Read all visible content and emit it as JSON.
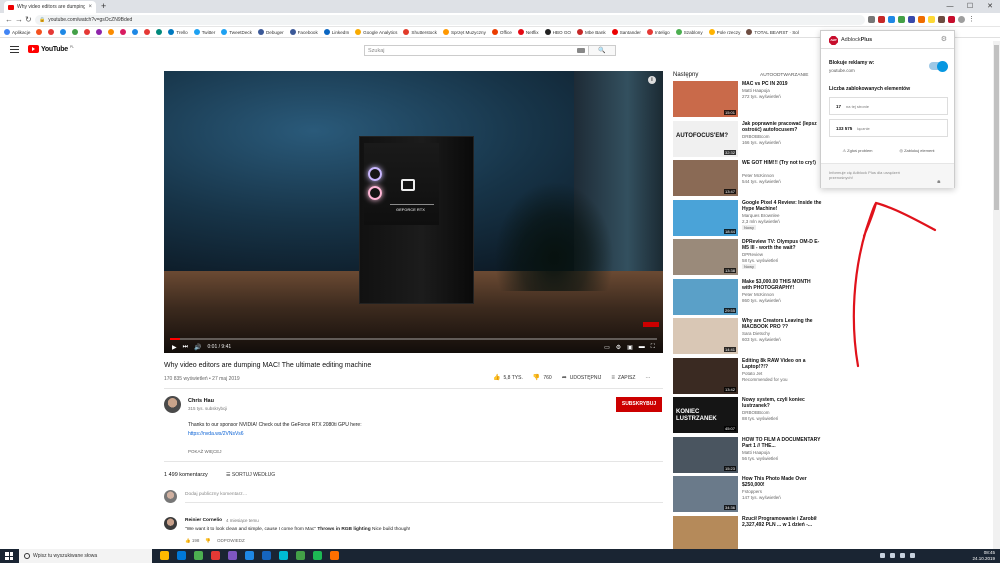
{
  "browser": {
    "tab_title": "Why video editors are dumping...",
    "tab_close": "×",
    "new_tab": "+",
    "url": "youtube.com/watch?v=gsOcZN9Bded",
    "back": "←",
    "forward": "→",
    "reload": "↻",
    "star": "☆",
    "win_min": "—",
    "win_max": "☐",
    "win_close": "✕",
    "menu": "⋮"
  },
  "bookmarks": [
    {
      "label": "Aplikacje",
      "color": "#4285f4"
    },
    {
      "label": "",
      "color": "#f4511e"
    },
    {
      "label": "",
      "color": "#e53935"
    },
    {
      "label": "",
      "color": "#1e88e5"
    },
    {
      "label": "",
      "color": "#43a047"
    },
    {
      "label": "",
      "color": "#e53935"
    },
    {
      "label": "",
      "color": "#8e24aa"
    },
    {
      "label": "",
      "color": "#fb8c00"
    },
    {
      "label": "",
      "color": "#d81b60"
    },
    {
      "label": "",
      "color": "#1e88e5"
    },
    {
      "label": "",
      "color": "#e53935"
    },
    {
      "label": "",
      "color": "#00897b"
    },
    {
      "label": "Trello",
      "color": "#0079bf"
    },
    {
      "label": "Twitter",
      "color": "#1da1f2"
    },
    {
      "label": "TweetDeck",
      "color": "#1da1f2"
    },
    {
      "label": "Debuger",
      "color": "#3b5998"
    },
    {
      "label": "Facebook",
      "color": "#3b5998"
    },
    {
      "label": "LinkedIn",
      "color": "#0a66c2"
    },
    {
      "label": "Google Analytics",
      "color": "#f9ab00"
    },
    {
      "label": "Shutterstock",
      "color": "#e23b2a"
    },
    {
      "label": "Sprzęt Muzyczny",
      "color": "#ff9800"
    },
    {
      "label": "Office",
      "color": "#eb3c00"
    },
    {
      "label": "Netflix",
      "color": "#e50914"
    },
    {
      "label": "HBO GO",
      "color": "#222222"
    },
    {
      "label": "Mbe Bank",
      "color": "#c62828"
    },
    {
      "label": "Santander",
      "color": "#ec0000"
    },
    {
      "label": "Inteligo",
      "color": "#e53935"
    },
    {
      "label": "Szablony",
      "color": "#4caf50"
    },
    {
      "label": "Pole rzeczy",
      "color": "#ffb300"
    },
    {
      "label": "TOTAL BEARST · Sol",
      "color": "#6d4c41"
    }
  ],
  "youtube": {
    "logo_text": "YouTube",
    "logo_country": "PL",
    "search_placeholder": "Szukaj",
    "search_icon": "🔍"
  },
  "video": {
    "title": "Why video editors are dumping MAC! The ultimate editing machine",
    "meta": "170 835 wyświetleń • 27 maj 2019",
    "time": "0:01 / 9:41",
    "progress": 0.02,
    "gpu_label": "GEFORCE RTX",
    "info": "i",
    "likes": "5,8 TYS.",
    "dislikes": "760",
    "share": "UDOSTĘPNIJ",
    "save": "ZAPISZ",
    "more": "···",
    "play": "▶",
    "next": "⏭",
    "volume": "🔊",
    "settings": "⚙",
    "fullscreen": "⛶"
  },
  "channel": {
    "name": "Chris Hau",
    "subs": "315 tys. subskrybcji",
    "subscribe": "SUBSKRYBUJ",
    "desc": "Thanks to our sponsor NVIDIA! Check out the GeForce RTX 2080ti GPU here:",
    "link": "https://nvda.ws/2VNsVs6",
    "show_more": "POKAŻ WIĘCEJ"
  },
  "comments": {
    "count": "1 499 komentarzy",
    "sort": "SORTUJ WEDŁUG",
    "add_placeholder": "Dodaj publiczny komentarz…",
    "items": [
      {
        "author": "Reinier Cornelio",
        "time": "4 miesiące temu",
        "text_pre": "\"We want it to look clean and simple, cause I come from Mac\" ",
        "text_bold": "Throws in RGB lighting",
        "text_post": " Nice build though!",
        "likes": "198",
        "reply": "ODPOWIEDZ"
      }
    ]
  },
  "sidebar": {
    "next": "Następny",
    "autoplay": "AUTOODTWARZANIE",
    "items": [
      {
        "title": "MAC vs PC IN 2019",
        "channel": "Matti Haapoja",
        "views": "272 tys. wyświetleń",
        "duration": "15:01",
        "new": "",
        "thumb": "#c96a4a"
      },
      {
        "title": "Jak poprawnie pracować (lepsz ostrość) autofocusem?",
        "channel": "DRBOBBcom",
        "views": "166 tys. wyświetleń",
        "duration": "32:32",
        "new": "",
        "thumb": "#f0f0f0",
        "thumb_text": "AUTOFOCUS'EM?"
      },
      {
        "title": "WE GOT HIM!!! (Try not to cry!)",
        "channel": "Peter McKinnon",
        "views": "544 tys. wyświetleń",
        "duration": "13:47",
        "new": "",
        "thumb": "#8a6a55"
      },
      {
        "title": "Google Pixel 4 Review: Inside the Hype Machine!",
        "channel": "Marques Brownlee",
        "views": "2,3 mln wyświetleń",
        "duration": "18:44",
        "new": "Nowy",
        "thumb": "#4aa3d8"
      },
      {
        "title": "DPReview TV: Olympus OM-D E-M5 III - worth the wait?",
        "channel": "DPReview",
        "views": "58 tys. wyświetleń",
        "duration": "13:38",
        "new": "Nowy",
        "thumb": "#9a8a7a"
      },
      {
        "title": "Make $3,000.00 THIS MONTH with PHOTOGRAPHY!",
        "channel": "Peter McKinnon",
        "views": "860 tys. wyświetleń",
        "duration": "29:55",
        "new": "",
        "thumb": "#5aa0c8"
      },
      {
        "title": "Why are Creators Leaving the MACBOOK PRO ??",
        "channel": "Sara Dietschy",
        "views": "603 tys. wyświetleń",
        "duration": "14:41",
        "new": "",
        "thumb": "#d9c7b5"
      },
      {
        "title": "Editing 8k RAW Video on a Laptop!?!?",
        "channel": "Potato Jet",
        "views": "Recommended for you",
        "duration": "13:42",
        "new": "",
        "thumb": "#3a2a22"
      },
      {
        "title": "Nowy system, czyli koniec lustrzanek?",
        "channel": "DRBOBBcom",
        "views": "88 tys. wyświetleń",
        "duration": "45:07",
        "new": "",
        "thumb": "#151515",
        "thumb_text": "KONIEC LUSTRZANEK"
      },
      {
        "title": "HOW TO FILM A DOCUMENTARY Part 1 // THE...",
        "channel": "Matti Haapoja",
        "views": "56 tys. wyświetleń",
        "duration": "15:23",
        "new": "",
        "thumb": "#4a5560"
      },
      {
        "title": "How This Photo Made Over $250,000!",
        "channel": "Fstoppers",
        "views": "147 tys. wyświetleń",
        "duration": "34:36",
        "new": "",
        "thumb": "#6a7a8a"
      },
      {
        "title": "Rzucił Programowanie i Zarobił 2,327,492 PLN ... w 1 dzień -...",
        "channel": "",
        "views": "",
        "duration": "",
        "new": "",
        "thumb": "#b58a5a"
      }
    ]
  },
  "adblock": {
    "brand_light": "Adblock",
    "brand_bold": "Plus",
    "logo": "ABP",
    "blocking": "Blokuje reklamy w:",
    "domain": "youtube.com",
    "count_title": "Liczba zablokowanych elementów",
    "page_count": "17",
    "page_label": "na tej stronie",
    "total_count": "133 575",
    "total_label": "łącznie",
    "report": "Zgłoś problem",
    "block_el": "Zablokuj element",
    "footer": "Informuje cię Adblock Plus dla urządzeń przenośnych!",
    "gear": "⚙"
  },
  "annotation": {
    "arrow_color": "#e0121b"
  },
  "taskbar": {
    "search": "Wpisz tu wyszukiwane słowa",
    "time": "08:45",
    "date": "24.10.2019",
    "apps": [
      "#ffb900",
      "#0078d7",
      "#4caf50",
      "#e53935",
      "#7e57c2",
      "#1e88e5",
      "#1565c0",
      "#00bcd4",
      "#43a047",
      "#1db954",
      "#ff6f00"
    ]
  }
}
